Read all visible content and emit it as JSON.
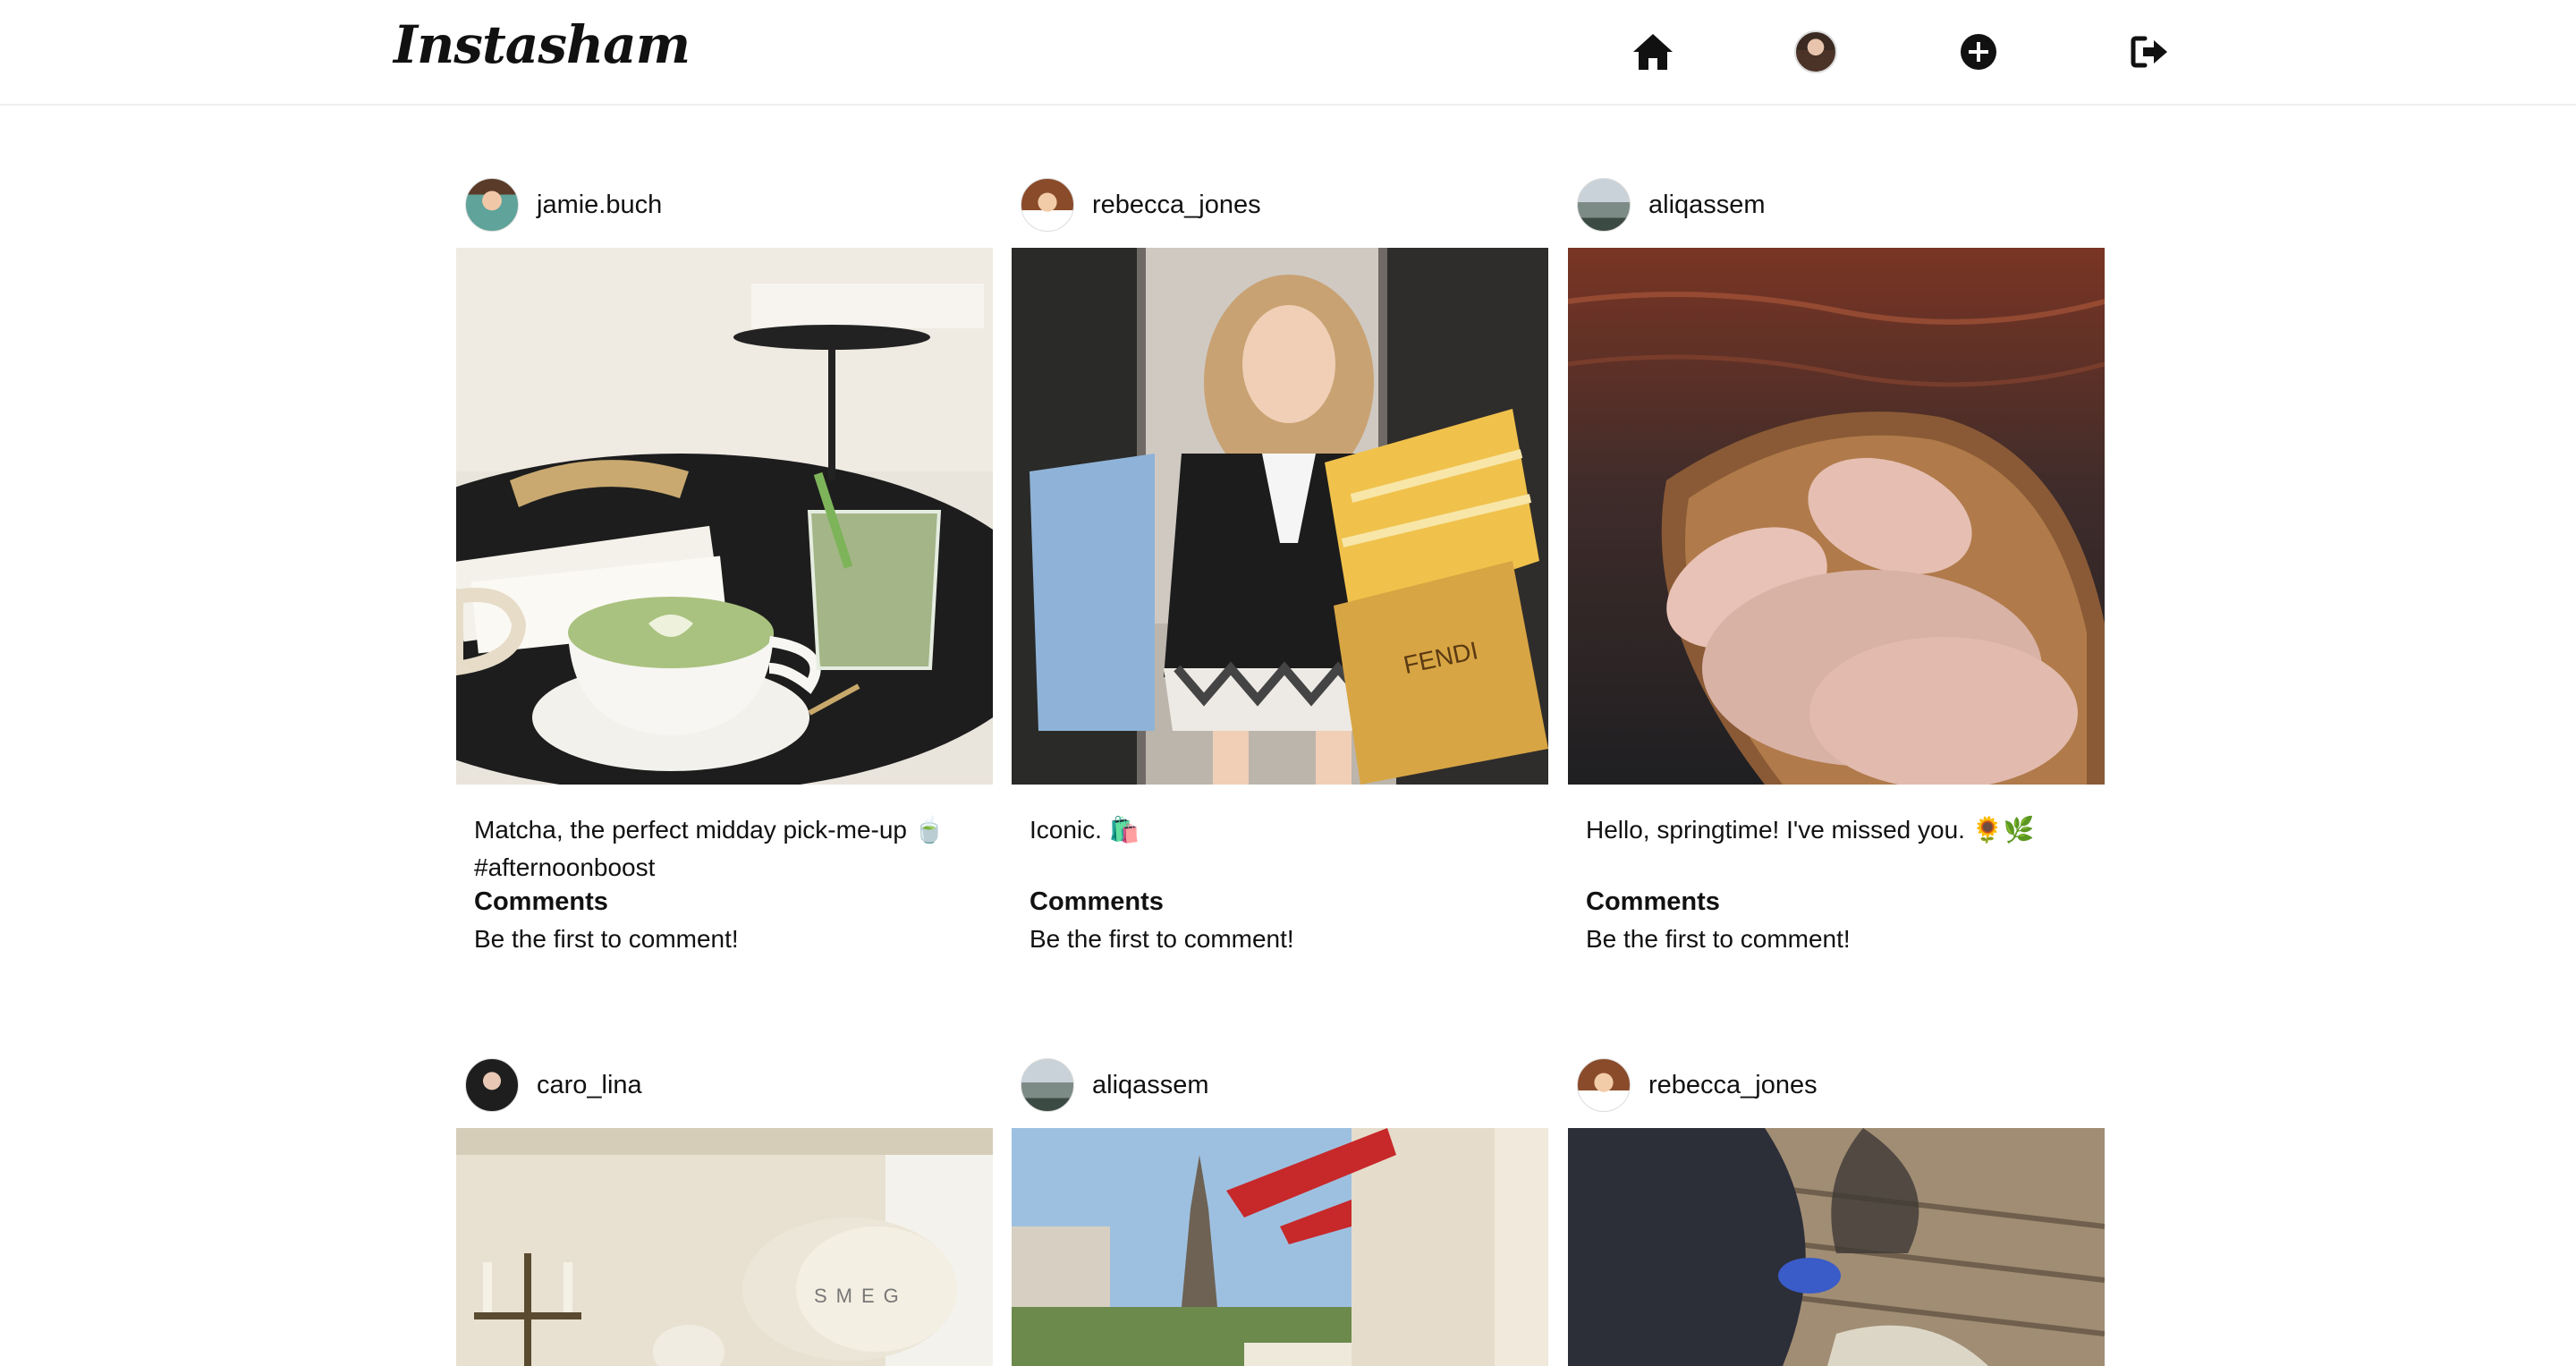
{
  "app": {
    "logo": "Instasham",
    "nav": [
      {
        "name": "home-icon"
      },
      {
        "name": "profile-avatar"
      },
      {
        "name": "add-post-icon"
      },
      {
        "name": "logout-icon"
      }
    ]
  },
  "posts": [
    {
      "username": "jamie.buch",
      "caption": "Matcha, the perfect midday pick-me-up 🍵 #afternoonboost",
      "comments_title": "Comments",
      "comments_empty": "Be the first to comment!",
      "photo_alt": "matcha latte on cafe table"
    },
    {
      "username": "rebecca_jones",
      "caption": "Iconic. 🛍️",
      "comments_title": "Comments",
      "comments_empty": "Be the first to comment!",
      "photo_alt": "woman with shopping bags"
    },
    {
      "username": "aliqassem",
      "caption": "Hello, springtime! I've missed you. 🌻🌿",
      "comments_title": "Comments",
      "comments_empty": "Be the first to comment!",
      "photo_alt": "boat with pillows on water"
    },
    {
      "username": "caro_lina",
      "photo_alt": "kitchen mixer by window"
    },
    {
      "username": "aliqassem",
      "photo_alt": "Eiffel tower street view"
    },
    {
      "username": "rebecca_jones",
      "photo_alt": "sneaker on wooden deck"
    }
  ],
  "colors": {
    "border": "#efefef",
    "text": "#111111"
  }
}
